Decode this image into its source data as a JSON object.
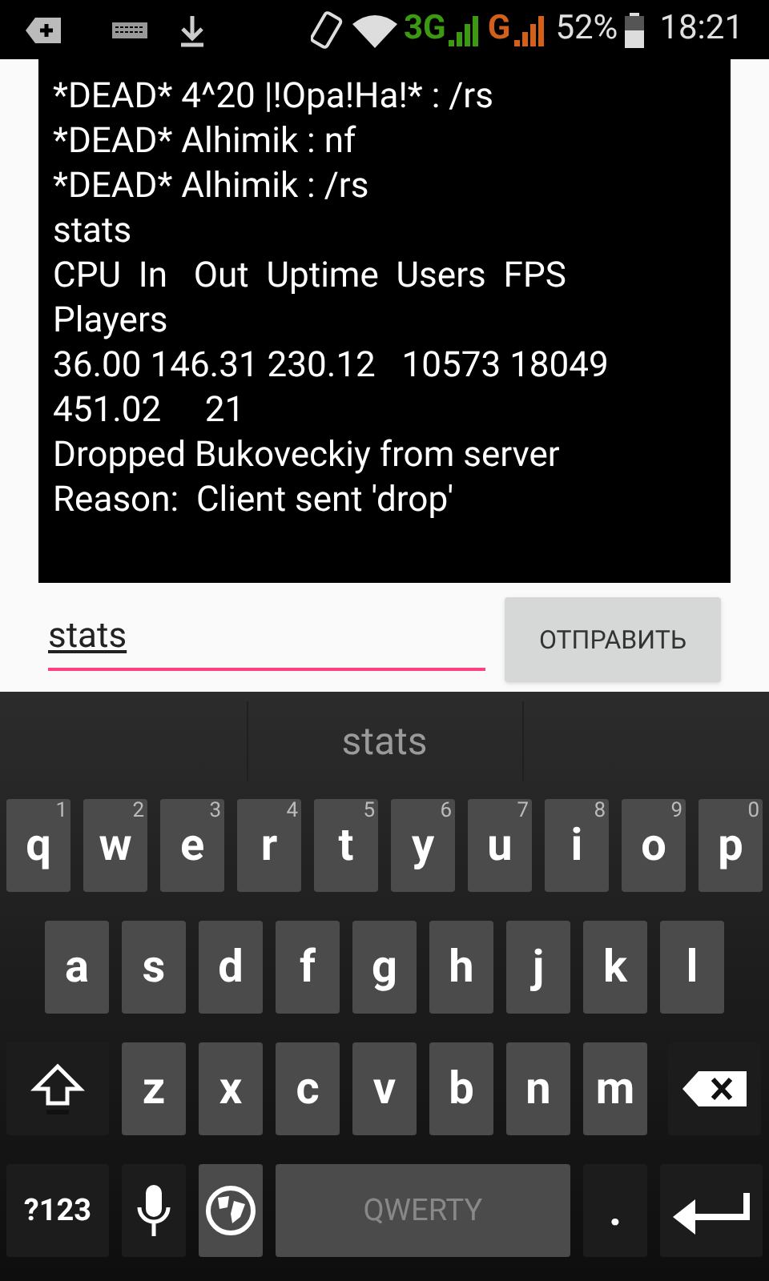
{
  "status_bar": {
    "networks": [
      {
        "label": "3G",
        "color": "#3c9a12"
      },
      {
        "label": "G",
        "color": "#d2601a"
      }
    ],
    "battery": "52%",
    "time": "18:21"
  },
  "console": {
    "lines": [
      "*DEAD* 4^20 |!Opa!Ha!* : /rs",
      "*DEAD* Alhimik : nf",
      "*DEAD* Alhimik : /rs",
      "stats",
      "CPU  In   Out  Uptime  Users  FPS",
      "Players",
      "36.00 146.31 230.12   10573 18049",
      "451.02     21",
      "Dropped Bukoveckiy from server",
      "Reason:  Client sent 'drop'"
    ]
  },
  "input": {
    "value": "stats"
  },
  "send_button": "ОТПРАВИТЬ",
  "keyboard": {
    "suggestions": [
      "stats"
    ],
    "rows": [
      {
        "keys": [
          {
            "kind": "letter",
            "label": "q",
            "hint": "1"
          },
          {
            "kind": "letter",
            "label": "w",
            "hint": "2"
          },
          {
            "kind": "letter",
            "label": "e",
            "hint": "3"
          },
          {
            "kind": "letter",
            "label": "r",
            "hint": "4"
          },
          {
            "kind": "letter",
            "label": "t",
            "hint": "5"
          },
          {
            "kind": "letter",
            "label": "y",
            "hint": "6"
          },
          {
            "kind": "letter",
            "label": "u",
            "hint": "7"
          },
          {
            "kind": "letter",
            "label": "i",
            "hint": "8"
          },
          {
            "kind": "letter",
            "label": "o",
            "hint": "9"
          },
          {
            "kind": "letter",
            "label": "p",
            "hint": "0"
          }
        ]
      },
      {
        "keys": [
          {
            "kind": "letter",
            "label": "a"
          },
          {
            "kind": "letter",
            "label": "s"
          },
          {
            "kind": "letter",
            "label": "d"
          },
          {
            "kind": "letter",
            "label": "f"
          },
          {
            "kind": "letter",
            "label": "g"
          },
          {
            "kind": "letter",
            "label": "h"
          },
          {
            "kind": "letter",
            "label": "j"
          },
          {
            "kind": "letter",
            "label": "k"
          },
          {
            "kind": "letter",
            "label": "l"
          }
        ]
      },
      {
        "keys": [
          {
            "kind": "shift"
          },
          {
            "kind": "letter",
            "label": "z"
          },
          {
            "kind": "letter",
            "label": "x"
          },
          {
            "kind": "letter",
            "label": "c"
          },
          {
            "kind": "letter",
            "label": "v"
          },
          {
            "kind": "letter",
            "label": "b"
          },
          {
            "kind": "letter",
            "label": "n"
          },
          {
            "kind": "letter",
            "label": "m"
          },
          {
            "kind": "backspace"
          }
        ]
      },
      {
        "keys": [
          {
            "kind": "symbols",
            "label": "?123"
          },
          {
            "kind": "mic"
          },
          {
            "kind": "globe"
          },
          {
            "kind": "space",
            "label": "QWERTY"
          },
          {
            "kind": "period",
            "label": "."
          },
          {
            "kind": "enter"
          }
        ]
      }
    ]
  }
}
